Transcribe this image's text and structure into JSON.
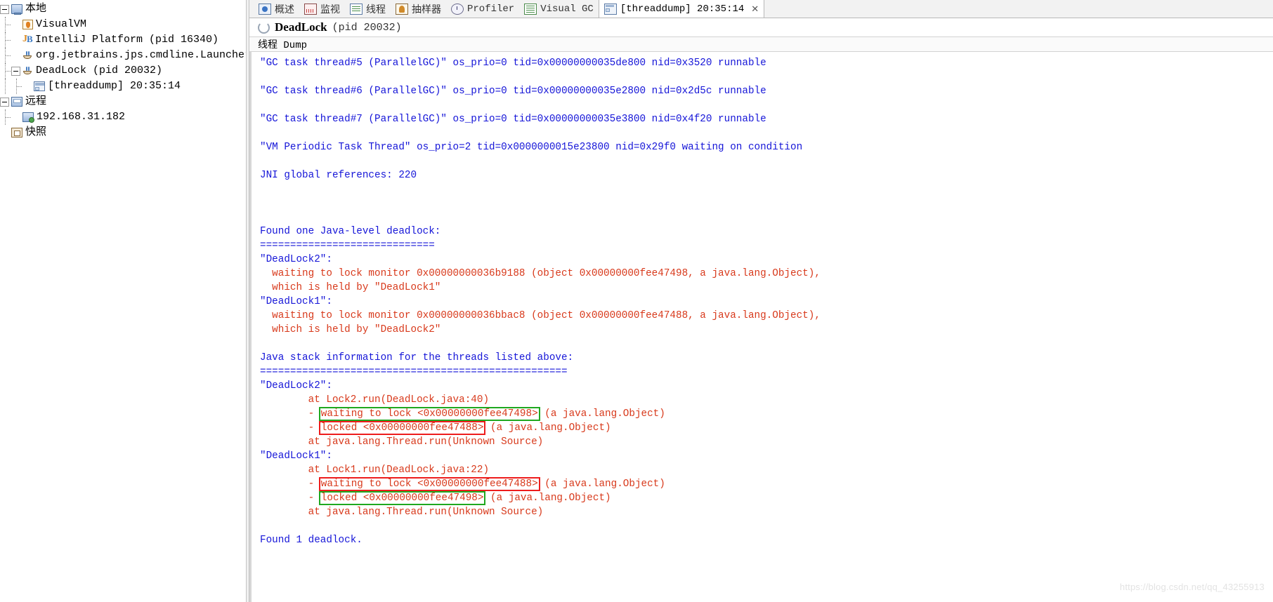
{
  "tree": {
    "nodes": [
      {
        "label": "本地",
        "icon": "computer-icon",
        "depth": 0,
        "twisty": "minus",
        "cjk": true
      },
      {
        "label": "VisualVM",
        "icon": "visualvm-icon",
        "depth": 1,
        "twisty": "none",
        "cjk": false
      },
      {
        "label": "IntelliJ Platform (pid 16340)",
        "icon": "intellij-icon",
        "depth": 1,
        "twisty": "none",
        "cjk": false
      },
      {
        "label": "org.jetbrains.jps.cmdline.Launcher (",
        "icon": "java-icon",
        "depth": 1,
        "twisty": "none",
        "cjk": false
      },
      {
        "label": "DeadLock (pid 20032)",
        "icon": "java-icon",
        "depth": 1,
        "twisty": "minus",
        "cjk": false
      },
      {
        "label": "[threaddump] 20:35:14",
        "icon": "threaddump-icon",
        "depth": 2,
        "twisty": "none",
        "cjk": false
      },
      {
        "label": "远程",
        "icon": "remote-icon",
        "depth": 0,
        "twisty": "minus",
        "cjk": true
      },
      {
        "label": "192.168.31.182",
        "icon": "host-icon",
        "depth": 1,
        "twisty": "none",
        "cjk": false
      },
      {
        "label": "快照",
        "icon": "snapshot-icon",
        "depth": 0,
        "twisty": "none",
        "cjk": true
      }
    ]
  },
  "tabs": [
    {
      "label": "概述",
      "icon": "overview-icon",
      "active": false,
      "closable": false
    },
    {
      "label": "监视",
      "icon": "monitor-icon",
      "active": false,
      "closable": false
    },
    {
      "label": "线程",
      "icon": "threads-icon",
      "active": false,
      "closable": false
    },
    {
      "label": "抽样器",
      "icon": "sampler-icon",
      "active": false,
      "closable": false
    },
    {
      "label": "Profiler",
      "icon": "profiler-icon",
      "active": false,
      "closable": false
    },
    {
      "label": "Visual GC",
      "icon": "visualgc-icon",
      "active": false,
      "closable": false
    },
    {
      "label": "[threaddump] 20:35:14",
      "icon": "threaddump-icon",
      "active": true,
      "closable": true
    }
  ],
  "tab_close_glyph": "✕",
  "header": {
    "spinner_icon": "loading-spinner-icon",
    "title": "DeadLock",
    "pid": "(pid 20032)"
  },
  "subtab": {
    "label": "线程 Dump"
  },
  "dump": {
    "lines": [
      {
        "text": "\"GC task thread#5 (ParallelGC)\" os_prio=0 tid=0x00000000035de800 nid=0x3520 runnable",
        "color": "blue"
      },
      {
        "text": "",
        "color": "blue"
      },
      {
        "text": "\"GC task thread#6 (ParallelGC)\" os_prio=0 tid=0x00000000035e2800 nid=0x2d5c runnable",
        "color": "blue"
      },
      {
        "text": "",
        "color": "blue"
      },
      {
        "text": "\"GC task thread#7 (ParallelGC)\" os_prio=0 tid=0x00000000035e3800 nid=0x4f20 runnable",
        "color": "blue"
      },
      {
        "text": "",
        "color": "blue"
      },
      {
        "text": "\"VM Periodic Task Thread\" os_prio=2 tid=0x0000000015e23800 nid=0x29f0 waiting on condition",
        "color": "blue"
      },
      {
        "text": "",
        "color": "blue"
      },
      {
        "text": "JNI global references: 220",
        "color": "blue"
      },
      {
        "text": "",
        "color": "blue"
      },
      {
        "text": "",
        "color": "blue"
      },
      {
        "text": "",
        "color": "blue"
      },
      {
        "text": "Found one Java-level deadlock:",
        "color": "blue"
      },
      {
        "text": "=============================",
        "color": "blue"
      },
      {
        "text": "\"DeadLock2\":",
        "color": "blue"
      },
      {
        "text": "  waiting to lock monitor 0x00000000036b9188 (object 0x00000000fee47498, a java.lang.Object),",
        "color": "red"
      },
      {
        "text": "  which is held by \"DeadLock1\"",
        "color": "red"
      },
      {
        "text": "\"DeadLock1\":",
        "color": "blue"
      },
      {
        "text": "  waiting to lock monitor 0x00000000036bbac8 (object 0x00000000fee47488, a java.lang.Object),",
        "color": "red"
      },
      {
        "text": "  which is held by \"DeadLock2\"",
        "color": "red"
      },
      {
        "text": "",
        "color": "blue"
      },
      {
        "text": "Java stack information for the threads listed above:",
        "color": "blue"
      },
      {
        "text": "===================================================",
        "color": "blue"
      },
      {
        "text": "\"DeadLock2\":",
        "color": "blue"
      },
      {
        "text": "        at Lock2.run(DeadLock.java:40)",
        "color": "red"
      },
      {
        "text": "        - ",
        "color": "red",
        "box": "green",
        "box_text": "waiting to lock <0x00000000fee47498>",
        "tail": " (a java.lang.Object)"
      },
      {
        "text": "        - ",
        "color": "red",
        "box": "red",
        "box_text": "locked <0x00000000fee47488>",
        "tail": " (a java.lang.Object)"
      },
      {
        "text": "        at java.lang.Thread.run(Unknown Source)",
        "color": "red"
      },
      {
        "text": "\"DeadLock1\":",
        "color": "blue"
      },
      {
        "text": "        at Lock1.run(DeadLock.java:22)",
        "color": "red"
      },
      {
        "text": "        - ",
        "color": "red",
        "box": "red",
        "box_text": "waiting to lock <0x00000000fee47488>",
        "tail": " (a java.lang.Object)"
      },
      {
        "text": "        - ",
        "color": "red",
        "box": "green",
        "box_text": "locked <0x00000000fee47498>",
        "tail": " (a java.lang.Object)"
      },
      {
        "text": "        at java.lang.Thread.run(Unknown Source)",
        "color": "red"
      },
      {
        "text": "",
        "color": "blue"
      },
      {
        "text": "Found 1 deadlock.",
        "color": "blue"
      }
    ]
  },
  "watermark": "https://blog.csdn.net/qq_43255913",
  "colors": {
    "text_blue": "#1515d8",
    "text_red": "#d8391b",
    "box_green": "#1fa81f",
    "box_red": "#ee1c1c"
  }
}
